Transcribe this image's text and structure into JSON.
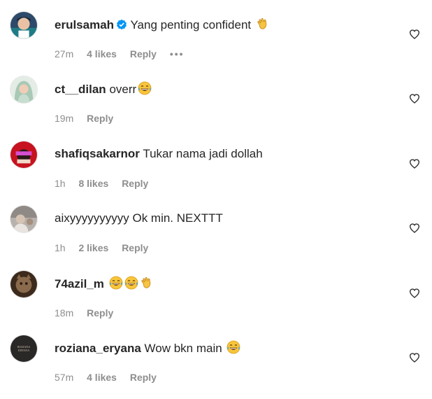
{
  "comments": [
    {
      "username": "erulsamah",
      "verified": true,
      "text": "Yang penting confident",
      "emojis": [
        "clap-hands-emoji"
      ],
      "time": "27m",
      "likes": "4 likes",
      "reply": "Reply",
      "more": "•••"
    },
    {
      "username": "ct__dilan",
      "verified": false,
      "text": "overr",
      "emojis": [
        "tears-of-joy-emoji"
      ],
      "time": "19m",
      "likes": "",
      "reply": "Reply"
    },
    {
      "username": "shafiqsakarnor",
      "verified": false,
      "text": "Tukar nama jadi dollah",
      "emojis": [],
      "time": "1h",
      "likes": "8 likes",
      "reply": "Reply"
    },
    {
      "username": "aixyyyyyyyyyy",
      "verified": false,
      "text": "Ok min. NEXTTT",
      "emojis": [],
      "time": "1h",
      "likes": "2 likes",
      "reply": "Reply"
    },
    {
      "username": "74azil_m",
      "verified": false,
      "text": "",
      "emojis": [
        "tears-of-joy-emoji",
        "tears-of-joy-emoji",
        "clap-hands-emoji"
      ],
      "time": "18m",
      "likes": "",
      "reply": "Reply"
    },
    {
      "username": "roziana_eryana",
      "verified": false,
      "text": "Wow bkn main",
      "emojis": [
        "tears-of-joy-emoji"
      ],
      "time": "57m",
      "likes": "4 likes",
      "reply": "Reply",
      "avatar_text": "ROZIANA ERYANA"
    }
  ],
  "icons": {
    "like": "heart-outline-icon",
    "verified": "verified-badge-icon"
  },
  "colors": {
    "muted": "#8e8e8e",
    "verified": "#0095f6",
    "text": "#262626"
  }
}
